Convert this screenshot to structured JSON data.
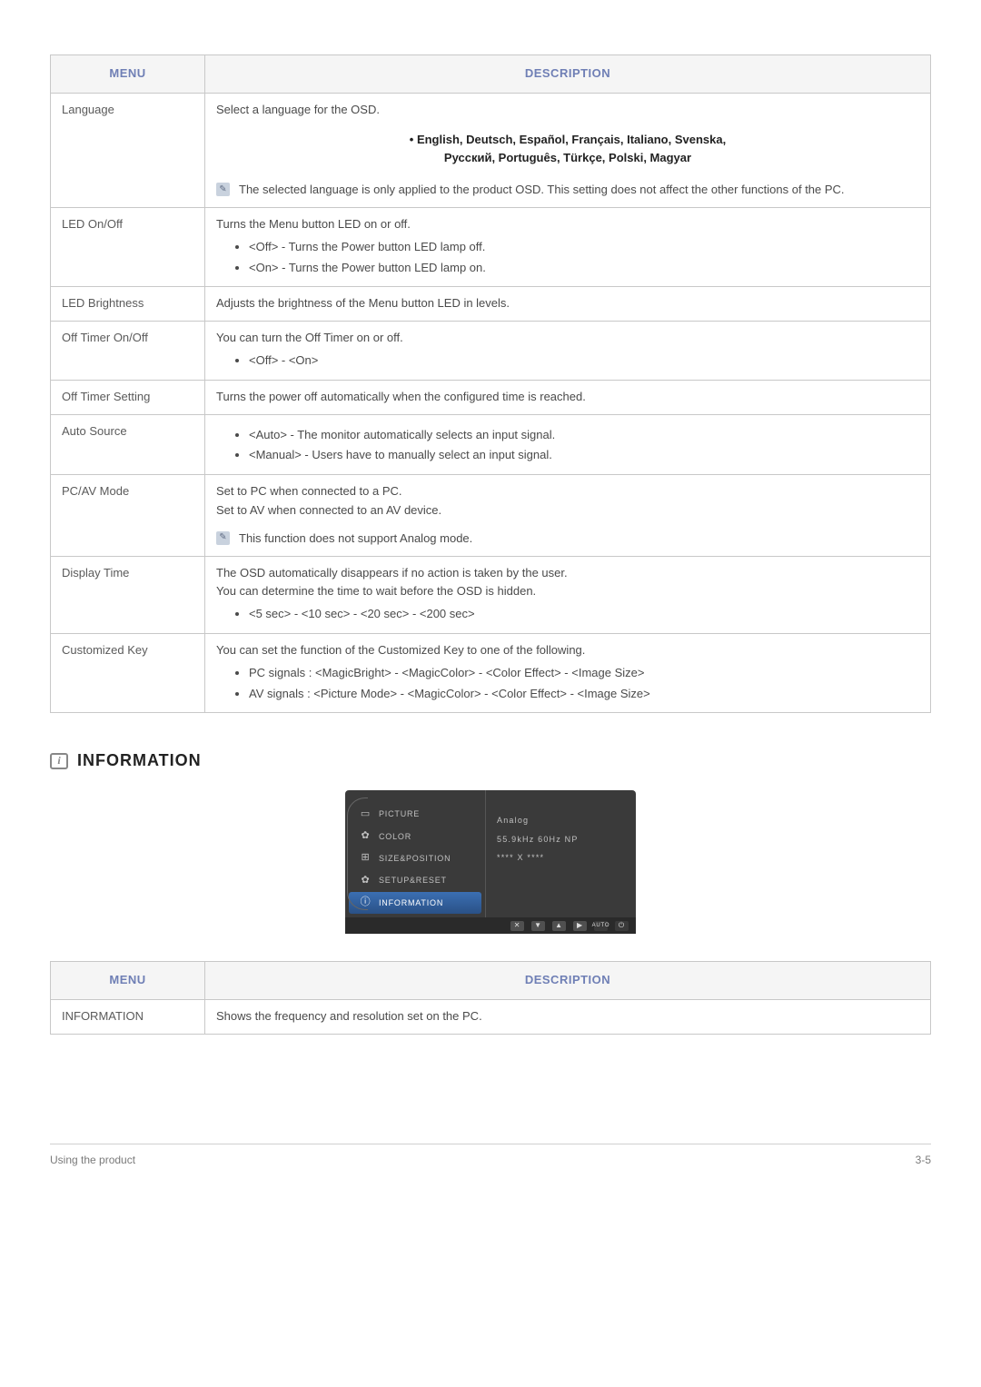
{
  "table1": {
    "headers": {
      "menu": "MENU",
      "desc": "DESCRIPTION"
    },
    "rows": {
      "language": {
        "menu": "Language",
        "text": "Select a language for the OSD.",
        "langs_line1": "• English, Deutsch, Español, Français, Italiano, Svenska,",
        "langs_line2": "Русский, Português, Türkçe, Polski, Magyar",
        "note": "The selected language is only applied to the product OSD. This setting does not affect the other functions of the PC."
      },
      "led_onoff": {
        "menu": "LED On/Off",
        "text": "Turns the Menu button LED on or off.",
        "b1": "<Off> - Turns the Power button LED lamp off.",
        "b2": "<On> - Turns the Power button LED lamp on."
      },
      "led_brightness": {
        "menu": "LED Brightness",
        "text": "Adjusts the brightness of the Menu button LED in levels."
      },
      "off_timer_onoff": {
        "menu": "Off Timer On/Off",
        "text": "You can turn the Off Timer on or off.",
        "b1": "<Off> - <On>"
      },
      "off_timer_setting": {
        "menu": "Off Timer Setting",
        "text": "Turns the power off automatically when the configured time is reached."
      },
      "auto_source": {
        "menu": "Auto Source",
        "b1": "<Auto> - The monitor automatically selects an input signal.",
        "b2": "<Manual> - Users have to manually select an input signal."
      },
      "pc_av": {
        "menu": "PC/AV Mode",
        "t1": "Set to PC when connected to a PC.",
        "t2": "Set to AV when connected to an AV device.",
        "note": "This function does not support Analog mode."
      },
      "display_time": {
        "menu": "Display Time",
        "t1": "The OSD automatically disappears if no action is taken by the user.",
        "t2": "You can determine the time to wait before the OSD is hidden.",
        "b1": "<5 sec> - <10 sec> - <20 sec> - <200 sec>"
      },
      "customized_key": {
        "menu": "Customized Key",
        "t1": "You can set the function of the Customized Key to one of the following.",
        "b1": "PC signals : <MagicBright> - <MagicColor> - <Color Effect> - <Image Size>",
        "b2": "AV signals : <Picture Mode> - <MagicColor> - <Color Effect> - <Image Size>"
      }
    }
  },
  "section_information_heading": "INFORMATION",
  "osd": {
    "items": [
      "PICTURE",
      "COLOR",
      "SIZE&POSITION",
      "SETUP&RESET",
      "INFORMATION"
    ],
    "right": {
      "source": "Analog",
      "freq": "55.9kHz 60Hz NP",
      "res": "**** X ****"
    }
  },
  "table2": {
    "headers": {
      "menu": "MENU",
      "desc": "DESCRIPTION"
    },
    "row": {
      "menu": "INFORMATION",
      "text": "Shows the frequency and resolution set on the PC."
    }
  },
  "footer": {
    "left": "Using the product",
    "right": "3-5"
  }
}
